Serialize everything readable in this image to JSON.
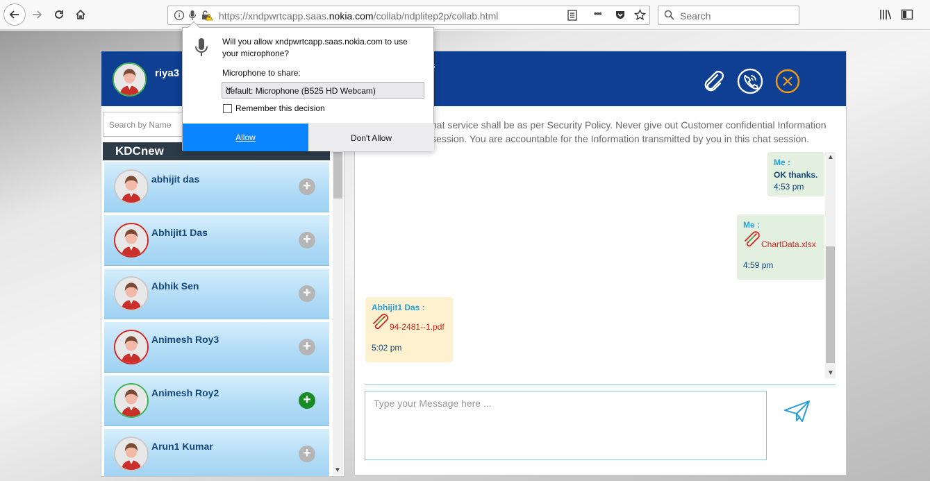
{
  "browser": {
    "url_prefix": "https://xndpwrtcapp.saas.",
    "url_domain": "nokia.com",
    "url_suffix": "/collab/ndplitep2p/collab.html",
    "search_placeholder": "Search",
    "more_label": "•••"
  },
  "permission": {
    "question": "Will you allow xndpwrtcapp.saas.nokia.com to use your microphone?",
    "share_label": "Microphone to share:",
    "selected_device": "default: Microphone (B525 HD Webcam)",
    "remember_label": "Remember this decision",
    "allow_label": "Allow",
    "deny_label": "Don't Allow"
  },
  "left": {
    "user_name": "riya3 r",
    "search_placeholder": "Search by Name",
    "group_name": "KDCnew",
    "contacts": [
      {
        "name": "abhijit das",
        "status": "offline"
      },
      {
        "name": "Abhijit1 Das",
        "status": "busy"
      },
      {
        "name": "Abhik Sen",
        "status": "offline"
      },
      {
        "name": "Animesh Roy3",
        "status": "busy"
      },
      {
        "name": "Animesh Roy2",
        "status": "online"
      },
      {
        "name": "Arun1 Kumar",
        "status": "offline"
      }
    ]
  },
  "right": {
    "header_partial": "s",
    "policy_text_line1": "hat service shall be as per Security Policy. Never give out Customer confidential Information",
    "policy_text_line2": "session. You are accountable for the Information transmitted by you in this chat session.",
    "messages": [
      {
        "sender": "Me :",
        "text": "OK thanks.",
        "time": "4:53 pm"
      },
      {
        "sender": "Me :",
        "file": "ChartData.xlsx",
        "time": "4:59 pm"
      },
      {
        "sender": "Abhijit1 Das :",
        "file": "94-2481--1.pdf",
        "time": "5:02 pm"
      }
    ],
    "input_placeholder": "Type your Message here ..."
  },
  "colors": {
    "header_blue": "#0e3f93",
    "allow_blue": "#0a84ff",
    "online_green": "#3fb34f",
    "busy_red": "#d6261f"
  }
}
